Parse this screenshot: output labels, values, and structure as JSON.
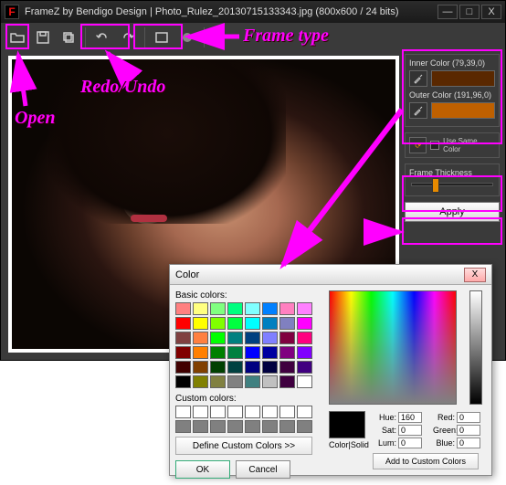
{
  "titlebar": {
    "icon_letter": "F",
    "title": "FrameZ by Bendigo Design | Photo_Rulez_20130715133343.jpg (800x600 / 24 bits)",
    "min": "—",
    "max": "□",
    "close": "X"
  },
  "toolbar": {
    "help": "?"
  },
  "annotations": {
    "frame_type": "Frame type",
    "redo_undo": "Redo/Undo",
    "open": "Open"
  },
  "right_panel": {
    "inner_label": "Inner Color (79,39,0)",
    "outer_label": "Outer Color (191,96,0)",
    "same_label": "Use Same Color",
    "thick_label": "Frame Thickness",
    "apply": "Apply"
  },
  "color_dialog": {
    "title": "Color",
    "close": "X",
    "basic_label": "Basic colors:",
    "custom_label": "Custom colors:",
    "define": "Define Custom Colors >>",
    "ok": "OK",
    "cancel": "Cancel",
    "colorsolid": "Color|Solid",
    "hue_l": "Hue:",
    "hue_v": "160",
    "sat_l": "Sat:",
    "sat_v": "0",
    "lum_l": "Lum:",
    "lum_v": "0",
    "red_l": "Red:",
    "red_v": "0",
    "green_l": "Green:",
    "green_v": "0",
    "blue_l": "Blue:",
    "blue_v": "0",
    "add": "Add to Custom Colors",
    "basic_colors": [
      "#ff8080",
      "#ffff80",
      "#80ff80",
      "#00ff80",
      "#80ffff",
      "#0080ff",
      "#ff80c0",
      "#ff80ff",
      "#ff0000",
      "#ffff00",
      "#80ff00",
      "#00ff40",
      "#00ffff",
      "#0080c0",
      "#8080c0",
      "#ff00ff",
      "#804040",
      "#ff8040",
      "#00ff00",
      "#008080",
      "#004080",
      "#8080ff",
      "#800040",
      "#ff0080",
      "#800000",
      "#ff8000",
      "#008000",
      "#008040",
      "#0000ff",
      "#0000a0",
      "#800080",
      "#8000ff",
      "#400000",
      "#804000",
      "#004000",
      "#004040",
      "#000080",
      "#000040",
      "#400040",
      "#400080",
      "#000000",
      "#808000",
      "#808040",
      "#808080",
      "#408080",
      "#c0c0c0",
      "#400040",
      "#ffffff"
    ],
    "custom_colors": [
      "#ffffff",
      "#ffffff",
      "#ffffff",
      "#ffffff",
      "#ffffff",
      "#ffffff",
      "#ffffff",
      "#ffffff",
      "#808080",
      "#808080",
      "#808080",
      "#808080",
      "#808080",
      "#808080",
      "#808080",
      "#808080"
    ]
  }
}
